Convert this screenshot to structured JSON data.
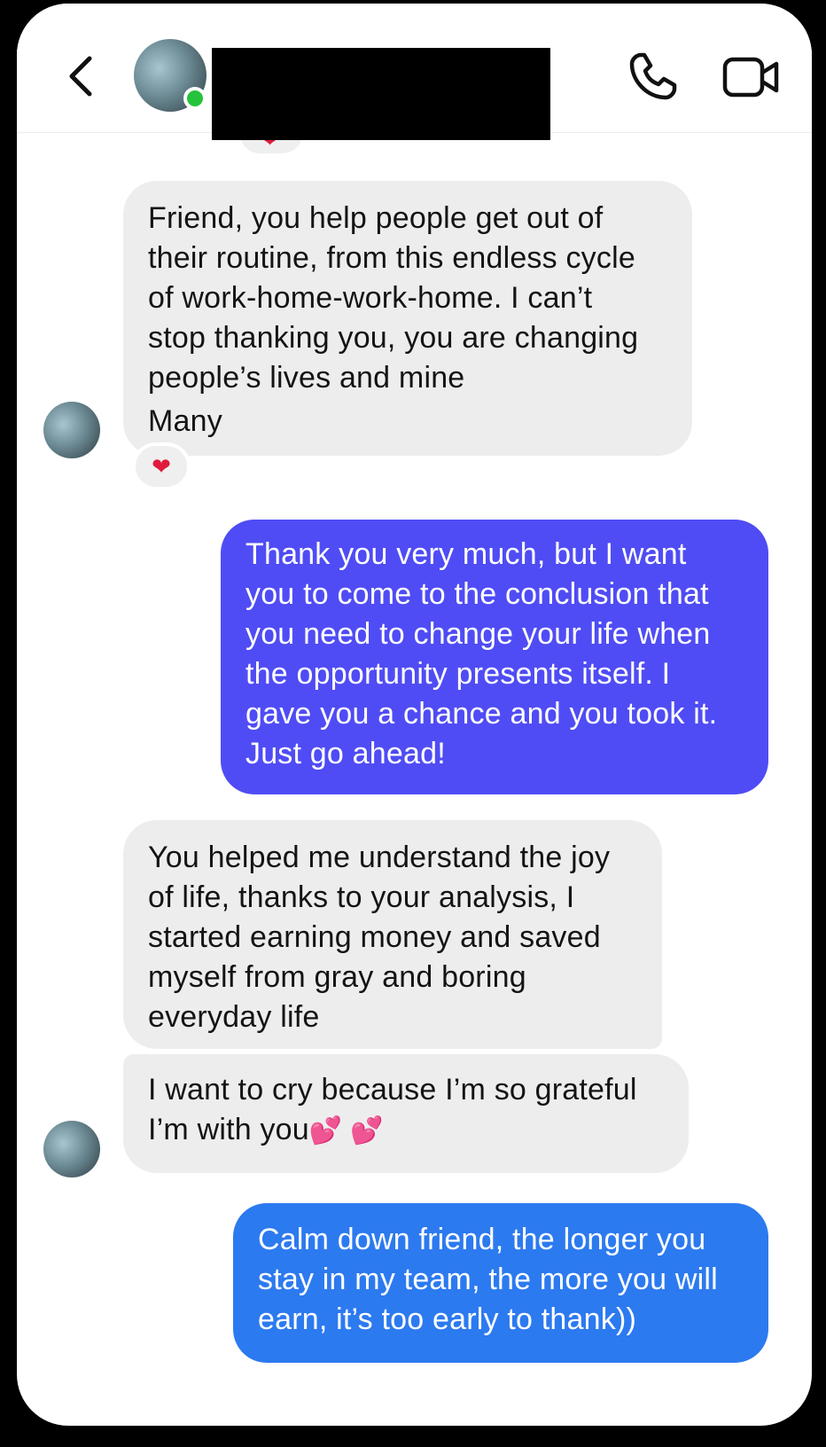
{
  "header": {
    "back_icon": "chevron-left-icon",
    "call_icon": "phone-icon",
    "video_icon": "video-camera-icon",
    "online_status_color": "#24c33b"
  },
  "colors": {
    "incoming_bubble": "#ededed",
    "outgoing_bubble_purple": "#4f4cf5",
    "outgoing_bubble_blue": "#2c7af0",
    "heart": "#e01b3c"
  },
  "messages": [
    {
      "direction": "incoming",
      "lines": [
        "Friend, you help people get out of",
        "their routine, from this endless cycle",
        "of work-home-work-home. I can’t",
        "stop thanking you, you are changing",
        "people’s lives and mine",
        "Many"
      ],
      "reaction": "❤"
    },
    {
      "direction": "outgoing",
      "lines": [
        "Thank you very much, but I want",
        "you to come to the conclusion that",
        "you need to change your life when",
        "the opportunity presents itself. I",
        "gave you a chance and you took it.",
        "Just go ahead!"
      ]
    },
    {
      "direction": "incoming",
      "lines": [
        "You helped me understand the joy",
        "of life, thanks to your analysis, I",
        "started earning money and saved",
        "myself from gray and boring",
        "everyday life"
      ]
    },
    {
      "direction": "incoming",
      "lines": [
        "I want to cry because I’m so grateful",
        "I’m with you"
      ],
      "emoji": "💕 💕"
    },
    {
      "direction": "outgoing",
      "lines": [
        "Calm down friend, the longer you",
        "stay in my team, the more you will",
        "earn, it’s too early to thank))"
      ]
    }
  ]
}
